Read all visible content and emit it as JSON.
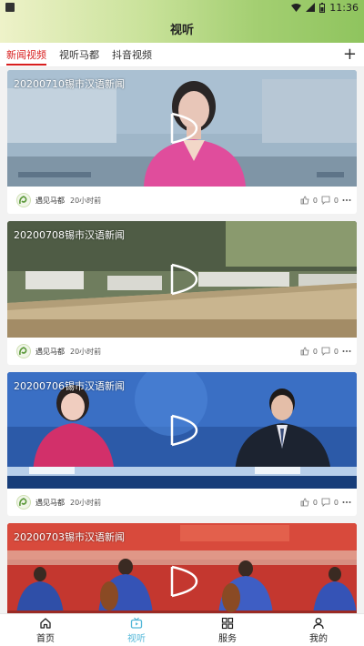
{
  "status_bar": {
    "time": "11:36"
  },
  "header": {
    "title": "视听"
  },
  "tabs": [
    {
      "label": "新闻视频",
      "active": true
    },
    {
      "label": "视听马都",
      "active": false
    },
    {
      "label": "抖音视频",
      "active": false
    }
  ],
  "tab_add_label": "+",
  "videos": [
    {
      "title": "20200710锡市汉语新闻",
      "source": "遇见马都",
      "time": "20小时前",
      "likes": "0",
      "comments": "0"
    },
    {
      "title": "20200708锡市汉语新闻",
      "source": "遇见马都",
      "time": "20小时前",
      "likes": "0",
      "comments": "0"
    },
    {
      "title": "20200706锡市汉语新闻",
      "source": "遇见马都",
      "time": "20小时前",
      "likes": "0",
      "comments": "0"
    },
    {
      "title": "20200703锡市汉语新闻"
    }
  ],
  "bottom_nav": [
    {
      "label": "首页",
      "icon": "home-icon"
    },
    {
      "label": "视听",
      "icon": "tv-icon",
      "active": true
    },
    {
      "label": "服务",
      "icon": "grid-icon"
    },
    {
      "label": "我的",
      "icon": "user-icon"
    }
  ],
  "colors": {
    "accent_tab": "#d81e1e",
    "accent_nav": "#52b7d8",
    "header_gradient_end": "#8fc45e"
  }
}
